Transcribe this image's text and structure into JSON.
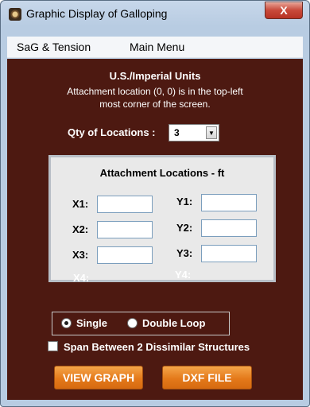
{
  "window": {
    "title": "Graphic Display of Galloping",
    "close_glyph": "X"
  },
  "menu": {
    "items": [
      "SaG & Tension",
      "Main Menu"
    ]
  },
  "header": {
    "units_title": "U.S./Imperial Units",
    "note_line1": "Attachment location (0, 0) is in the top-left",
    "note_line2": "most corner of the screen."
  },
  "quantity": {
    "label": "Qty of Locations :",
    "value": "3",
    "arrow_glyph": "▼"
  },
  "locations": {
    "title": "Attachment Locations -   ft",
    "x_labels": [
      "X1:",
      "X2:",
      "X3:",
      "X4:"
    ],
    "y_labels": [
      "Y1:",
      "Y2:",
      "Y3:",
      "Y4:"
    ],
    "x_values": [
      "",
      "",
      ""
    ],
    "y_values": [
      "",
      "",
      ""
    ]
  },
  "loop": {
    "single_label": "Single",
    "double_label": "Double Loop",
    "selected": "Single"
  },
  "span_checkbox": {
    "label": "Span Between 2 Dissimilar Structures",
    "checked": false
  },
  "buttons": {
    "view_graph": "VIEW GRAPH",
    "dxf_file": "DXF FILE"
  },
  "colors": {
    "background": "#4d1911",
    "button": "#e4791a",
    "panel": "#e9e9e9",
    "titlebar": "#b8cce2",
    "close": "#c8493a"
  },
  "icons": {
    "app": "galloping-app-icon",
    "close": "close-icon",
    "dropdown": "chevron-down-icon"
  }
}
